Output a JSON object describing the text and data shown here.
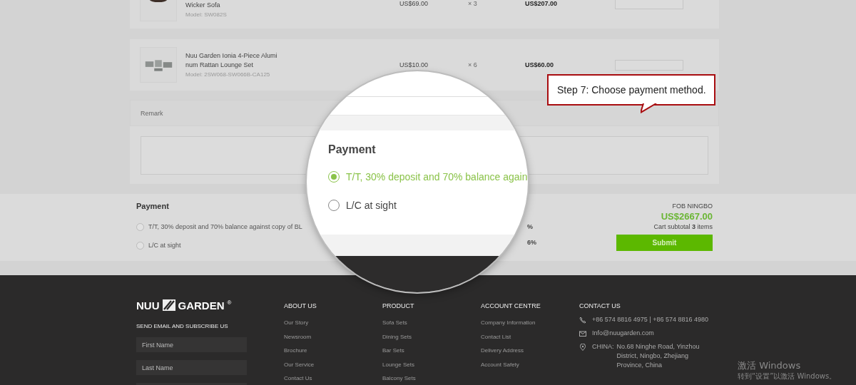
{
  "cart_items": [
    {
      "name": "Wicker Sofa",
      "model": "Model: SW082S",
      "price": "US$69.00",
      "quantity": "× 3",
      "total": "US$207.00"
    },
    {
      "name": "Nuu Garden Ionia 4-Piece Aluminum Rattan Lounge Set",
      "model": "Model: 2SW068-SW066B-CA125",
      "price": "US$10.00",
      "quantity": "× 6",
      "total": "US$60.00"
    }
  ],
  "remark": {
    "label": "Remark"
  },
  "payment": {
    "title": "Payment",
    "options": [
      {
        "label": "T/T, 30% deposit and 70% balance against copy of BL",
        "selected": false
      },
      {
        "label": "L/C at sight",
        "selected": false
      }
    ],
    "column_3": [
      "%",
      "6%"
    ]
  },
  "summary": {
    "incoterm": "FOB NINGBO",
    "total": "US$2667.00",
    "subtotal": "Cart subtotal **3** items",
    "submit": "Submit"
  },
  "callout": {
    "text": "Step 7: Choose payment method."
  },
  "magnifier": {
    "title": "Payment",
    "options": [
      {
        "label": "T/T, 30% deposit and 70% balance again",
        "selected": true
      },
      {
        "label": "L/C at sight",
        "selected": false
      }
    ]
  },
  "footer": {
    "logo": {
      "left": "NUU",
      "right": "GARDEN",
      "mark": "®"
    },
    "subscribe": {
      "title": "SEND EMAIL AND SUBSCRIBE US",
      "fields": [
        {
          "kind": "text",
          "placeholder": "First Name"
        },
        {
          "kind": "text",
          "placeholder": "Last Name"
        },
        {
          "kind": "text"
        }
      ]
    },
    "columns": [
      {
        "title": "ABOUT US",
        "links": [
          "Our Story",
          "Newsroom",
          "Brochure",
          "Our Service",
          "Contact Us"
        ]
      },
      {
        "title": "PRODUCT",
        "links": [
          "Sofa Sets",
          "Dining Sets",
          "Bar Sets",
          "Lounge Sets",
          "Balcony Sets"
        ]
      },
      {
        "title": "ACCOUNT CENTRE",
        "links": [
          "Company Information",
          "Contact List",
          "Delivery Address",
          "Account Safety"
        ]
      }
    ],
    "contact": {
      "title": "CONTACT US",
      "items": [
        {
          "kind": "phone",
          "text": "+86 574 8816 4975 | +86 574 8816 4980"
        },
        {
          "kind": "email",
          "text": "Info@nuugarden.com"
        },
        {
          "kind": "location",
          "label": "CHINA:",
          "text": "No.68 Ninghe Road, Yinzhou District, Ningbo, Zhejiang Province, China"
        }
      ]
    }
  },
  "os_watermark": {
    "title": "激活 Windows",
    "subtitle": "转到“设置”以激活 Windows。"
  }
}
